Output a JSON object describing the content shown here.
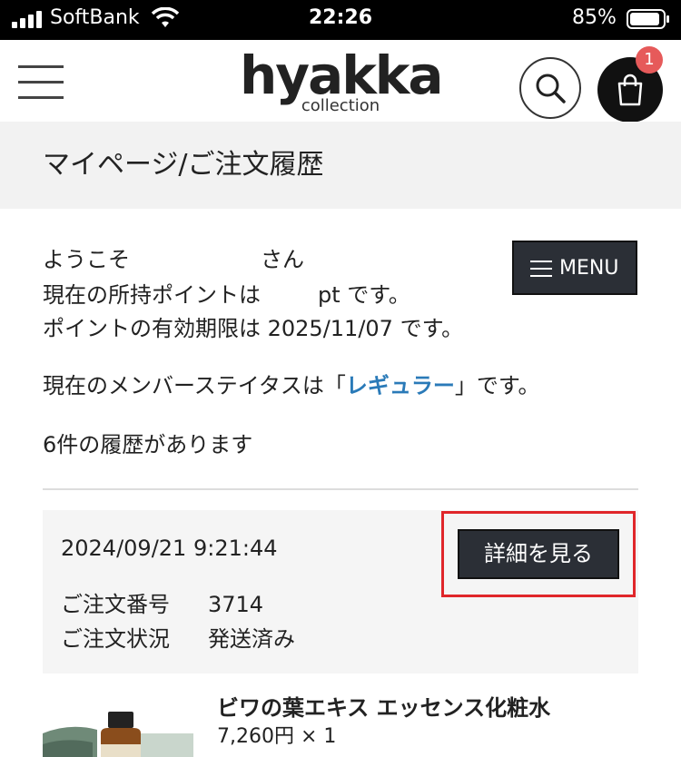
{
  "status_bar": {
    "carrier": "SoftBank",
    "time": "22:26",
    "battery": "85%"
  },
  "header": {
    "logo": "hyakka",
    "logo_sub": "collection",
    "cart_count": "1"
  },
  "page_title": "マイページ/ご注文履歴",
  "welcome": {
    "greeting_prefix": "ようこそ",
    "greeting_suffix": "さん",
    "points_prefix": "現在の所持ポイントは",
    "points_suffix": "pt です。",
    "expiry": "ポイントの有効期限は 2025/11/07 です。",
    "status_prefix": "現在のメンバーステイタスは「",
    "status_value": "レギュラー",
    "status_suffix": "」です。",
    "history_count": "6件の履歴があります"
  },
  "menu_button": "MENU",
  "order": {
    "date": "2024/09/21 9:21:44",
    "number_label": "ご注文番号",
    "number_value": "3714",
    "status_label": "ご注文状況",
    "status_value": "発送済み",
    "detail_button": "詳細を見る"
  },
  "product": {
    "name": "ビワの葉エキス エッセンス化粧水",
    "price": "7,260円 × 1"
  },
  "colors": {
    "accent_link": "#2a7ab8",
    "button_dark": "#2b2f36",
    "badge": "#e65a5a",
    "highlight_box": "#e0262a"
  }
}
